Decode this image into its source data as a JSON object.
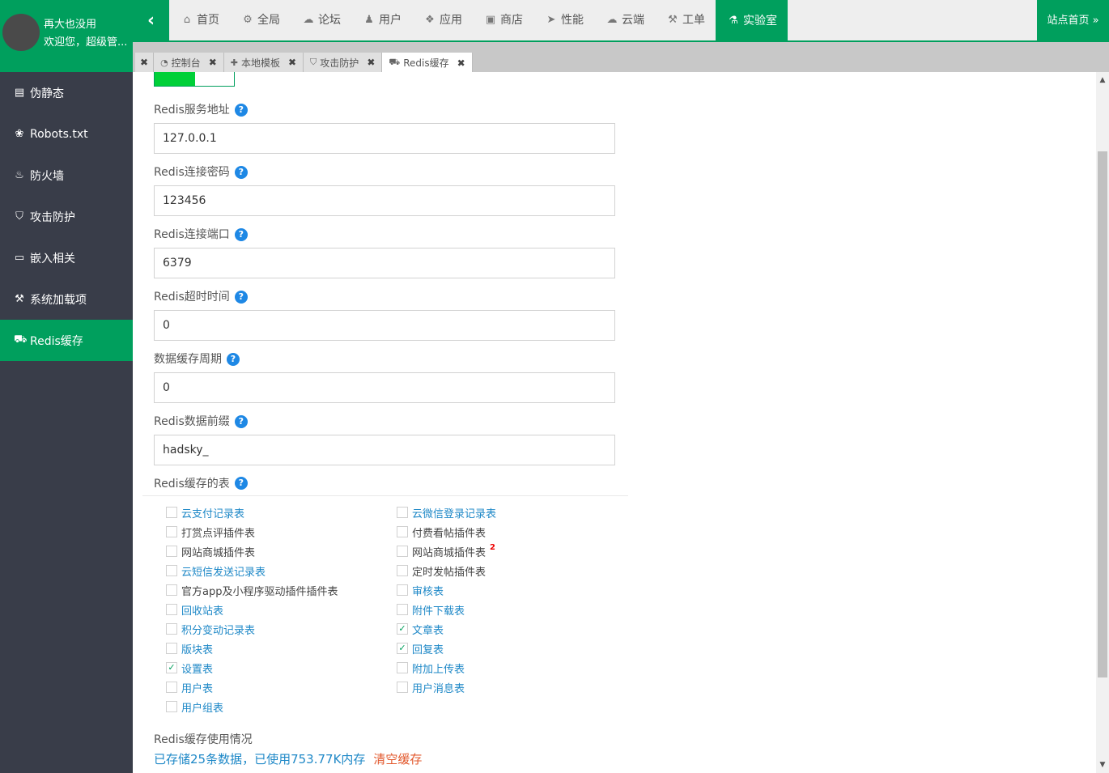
{
  "user": {
    "name": "再大也没用",
    "welcome": "欢迎您，超级管..."
  },
  "collapse_icon": "‹",
  "top_nav": [
    {
      "icon": "home-icon",
      "glyph": "⌂",
      "label": "首页"
    },
    {
      "icon": "cogs-icon",
      "glyph": "⚙",
      "label": "全局"
    },
    {
      "icon": "comments-icon",
      "glyph": "☁",
      "label": "论坛"
    },
    {
      "icon": "users-icon",
      "glyph": "♟",
      "label": "用户"
    },
    {
      "icon": "cubes-icon",
      "glyph": "❖",
      "label": "应用"
    },
    {
      "icon": "shopping-bag-icon",
      "glyph": "▣",
      "label": "商店"
    },
    {
      "icon": "paper-plane-icon",
      "glyph": "➤",
      "label": "性能"
    },
    {
      "icon": "cloud-icon",
      "glyph": "☁",
      "label": "云端"
    },
    {
      "icon": "wrench-icon",
      "glyph": "⚒",
      "label": "工单"
    },
    {
      "icon": "flask-icon",
      "glyph": "⚗",
      "label": "实验室"
    }
  ],
  "site_home": "站点首页 »",
  "tabs": [
    {
      "icon": "",
      "glyph": "",
      "label": ""
    },
    {
      "icon": "dashboard-icon",
      "glyph": "◔",
      "label": "控制台"
    },
    {
      "icon": "puzzle-icon",
      "glyph": "✚",
      "label": "本地模板"
    },
    {
      "icon": "shield-icon",
      "glyph": "⛉",
      "label": "攻击防护"
    },
    {
      "icon": "car-icon",
      "glyph": "⛟",
      "label": "Redis缓存"
    }
  ],
  "tab_close": "✖",
  "sidebar": [
    {
      "icon": "file-text-icon",
      "glyph": "▤",
      "label": "伪静态"
    },
    {
      "icon": "paw-icon",
      "glyph": "❀",
      "label": "Robots.txt"
    },
    {
      "icon": "fire-icon",
      "glyph": "♨",
      "label": "防火墙"
    },
    {
      "icon": "shield-icon",
      "glyph": "⛉",
      "label": "攻击防护"
    },
    {
      "icon": "inbox-icon",
      "glyph": "▭",
      "label": "嵌入相关"
    },
    {
      "icon": "wrench-icon",
      "glyph": "⚒",
      "label": "系统加载项"
    },
    {
      "icon": "car-icon",
      "glyph": "⛟",
      "label": "Redis缓存"
    }
  ],
  "help_glyph": "?",
  "fields": [
    {
      "label": "Redis服务地址",
      "value": "127.0.0.1"
    },
    {
      "label": "Redis连接密码",
      "value": "123456"
    },
    {
      "label": "Redis连接端口",
      "value": "6379"
    },
    {
      "label": "Redis超时时间",
      "value": "0"
    },
    {
      "label": "数据缓存周期",
      "value": "0"
    },
    {
      "label": "Redis数据前缀",
      "value": "hadsky_"
    }
  ],
  "tables_label": "Redis缓存的表",
  "check_mark": "✓",
  "tables_left": [
    {
      "label": "云支付记录表",
      "checked": false,
      "link": true
    },
    {
      "label": "打赏点评插件表",
      "checked": false,
      "link": false
    },
    {
      "label": "网站商城插件表",
      "checked": false,
      "link": false
    },
    {
      "label": "云短信发送记录表",
      "checked": false,
      "link": true
    },
    {
      "label": "官方app及小程序驱动插件插件表",
      "checked": false,
      "link": false
    },
    {
      "label": "回收站表",
      "checked": false,
      "link": true
    },
    {
      "label": "积分变动记录表",
      "checked": false,
      "link": true
    },
    {
      "label": "版块表",
      "checked": false,
      "link": true
    },
    {
      "label": "设置表",
      "checked": true,
      "link": true
    },
    {
      "label": "用户表",
      "checked": false,
      "link": true
    },
    {
      "label": "用户组表",
      "checked": false,
      "link": true
    }
  ],
  "tables_right": [
    {
      "label": "云微信登录记录表",
      "checked": false,
      "link": true
    },
    {
      "label": "付费看帖插件表",
      "checked": false,
      "link": false
    },
    {
      "label": "网站商城插件表",
      "checked": false,
      "link": false,
      "sup": "2"
    },
    {
      "label": "定时发帖插件表",
      "checked": false,
      "link": false
    },
    {
      "label": "审核表",
      "checked": false,
      "link": true
    },
    {
      "label": "附件下载表",
      "checked": false,
      "link": true
    },
    {
      "label": "文章表",
      "checked": true,
      "link": true
    },
    {
      "label": "回复表",
      "checked": true,
      "link": true
    },
    {
      "label": "附加上传表",
      "checked": false,
      "link": true
    },
    {
      "label": "用户消息表",
      "checked": false,
      "link": true
    }
  ],
  "usage": {
    "label": "Redis缓存使用情况",
    "text": "已存储25条数据，已使用753.77K内存",
    "clear": "清空缓存"
  },
  "scroll": {
    "up": "▲",
    "down": "▼"
  },
  "colors": {
    "primary": "#009f5d",
    "sidebar": "#393d49",
    "link": "#1e88c7",
    "danger": "#e2572b",
    "switch_on": "#00d038"
  }
}
